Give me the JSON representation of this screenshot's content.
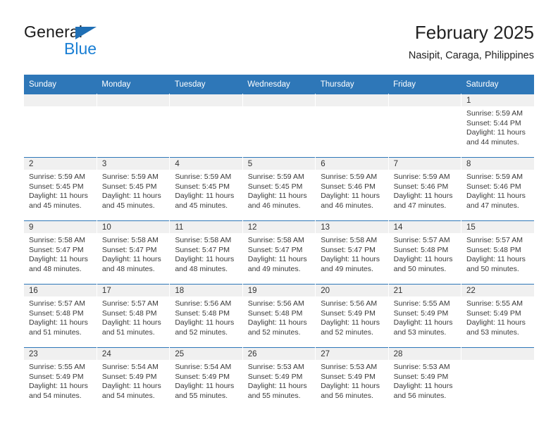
{
  "brand": {
    "name_part1": "General",
    "name_part2": "Blue",
    "triangle_color": "#1f6fb5",
    "blue_color": "#1a7fd4"
  },
  "header": {
    "month_title": "February 2025",
    "location": "Nasipit, Caraga, Philippines"
  },
  "theme": {
    "header_row_bg": "#2e77b8",
    "daynum_band_bg": "#f0f0f0",
    "row_divider": "#2e77b8"
  },
  "weekday_headers": [
    "Sunday",
    "Monday",
    "Tuesday",
    "Wednesday",
    "Thursday",
    "Friday",
    "Saturday"
  ],
  "weeks": [
    [
      {
        "day": "",
        "empty": true
      },
      {
        "day": "",
        "empty": true
      },
      {
        "day": "",
        "empty": true
      },
      {
        "day": "",
        "empty": true
      },
      {
        "day": "",
        "empty": true
      },
      {
        "day": "",
        "empty": true
      },
      {
        "day": "1",
        "sunrise": "Sunrise: 5:59 AM",
        "sunset": "Sunset: 5:44 PM",
        "daylight": "Daylight: 11 hours and 44 minutes."
      }
    ],
    [
      {
        "day": "2",
        "sunrise": "Sunrise: 5:59 AM",
        "sunset": "Sunset: 5:45 PM",
        "daylight": "Daylight: 11 hours and 45 minutes."
      },
      {
        "day": "3",
        "sunrise": "Sunrise: 5:59 AM",
        "sunset": "Sunset: 5:45 PM",
        "daylight": "Daylight: 11 hours and 45 minutes."
      },
      {
        "day": "4",
        "sunrise": "Sunrise: 5:59 AM",
        "sunset": "Sunset: 5:45 PM",
        "daylight": "Daylight: 11 hours and 45 minutes."
      },
      {
        "day": "5",
        "sunrise": "Sunrise: 5:59 AM",
        "sunset": "Sunset: 5:45 PM",
        "daylight": "Daylight: 11 hours and 46 minutes."
      },
      {
        "day": "6",
        "sunrise": "Sunrise: 5:59 AM",
        "sunset": "Sunset: 5:46 PM",
        "daylight": "Daylight: 11 hours and 46 minutes."
      },
      {
        "day": "7",
        "sunrise": "Sunrise: 5:59 AM",
        "sunset": "Sunset: 5:46 PM",
        "daylight": "Daylight: 11 hours and 47 minutes."
      },
      {
        "day": "8",
        "sunrise": "Sunrise: 5:59 AM",
        "sunset": "Sunset: 5:46 PM",
        "daylight": "Daylight: 11 hours and 47 minutes."
      }
    ],
    [
      {
        "day": "9",
        "sunrise": "Sunrise: 5:58 AM",
        "sunset": "Sunset: 5:47 PM",
        "daylight": "Daylight: 11 hours and 48 minutes."
      },
      {
        "day": "10",
        "sunrise": "Sunrise: 5:58 AM",
        "sunset": "Sunset: 5:47 PM",
        "daylight": "Daylight: 11 hours and 48 minutes."
      },
      {
        "day": "11",
        "sunrise": "Sunrise: 5:58 AM",
        "sunset": "Sunset: 5:47 PM",
        "daylight": "Daylight: 11 hours and 48 minutes."
      },
      {
        "day": "12",
        "sunrise": "Sunrise: 5:58 AM",
        "sunset": "Sunset: 5:47 PM",
        "daylight": "Daylight: 11 hours and 49 minutes."
      },
      {
        "day": "13",
        "sunrise": "Sunrise: 5:58 AM",
        "sunset": "Sunset: 5:47 PM",
        "daylight": "Daylight: 11 hours and 49 minutes."
      },
      {
        "day": "14",
        "sunrise": "Sunrise: 5:57 AM",
        "sunset": "Sunset: 5:48 PM",
        "daylight": "Daylight: 11 hours and 50 minutes."
      },
      {
        "day": "15",
        "sunrise": "Sunrise: 5:57 AM",
        "sunset": "Sunset: 5:48 PM",
        "daylight": "Daylight: 11 hours and 50 minutes."
      }
    ],
    [
      {
        "day": "16",
        "sunrise": "Sunrise: 5:57 AM",
        "sunset": "Sunset: 5:48 PM",
        "daylight": "Daylight: 11 hours and 51 minutes."
      },
      {
        "day": "17",
        "sunrise": "Sunrise: 5:57 AM",
        "sunset": "Sunset: 5:48 PM",
        "daylight": "Daylight: 11 hours and 51 minutes."
      },
      {
        "day": "18",
        "sunrise": "Sunrise: 5:56 AM",
        "sunset": "Sunset: 5:48 PM",
        "daylight": "Daylight: 11 hours and 52 minutes."
      },
      {
        "day": "19",
        "sunrise": "Sunrise: 5:56 AM",
        "sunset": "Sunset: 5:48 PM",
        "daylight": "Daylight: 11 hours and 52 minutes."
      },
      {
        "day": "20",
        "sunrise": "Sunrise: 5:56 AM",
        "sunset": "Sunset: 5:49 PM",
        "daylight": "Daylight: 11 hours and 52 minutes."
      },
      {
        "day": "21",
        "sunrise": "Sunrise: 5:55 AM",
        "sunset": "Sunset: 5:49 PM",
        "daylight": "Daylight: 11 hours and 53 minutes."
      },
      {
        "day": "22",
        "sunrise": "Sunrise: 5:55 AM",
        "sunset": "Sunset: 5:49 PM",
        "daylight": "Daylight: 11 hours and 53 minutes."
      }
    ],
    [
      {
        "day": "23",
        "sunrise": "Sunrise: 5:55 AM",
        "sunset": "Sunset: 5:49 PM",
        "daylight": "Daylight: 11 hours and 54 minutes."
      },
      {
        "day": "24",
        "sunrise": "Sunrise: 5:54 AM",
        "sunset": "Sunset: 5:49 PM",
        "daylight": "Daylight: 11 hours and 54 minutes."
      },
      {
        "day": "25",
        "sunrise": "Sunrise: 5:54 AM",
        "sunset": "Sunset: 5:49 PM",
        "daylight": "Daylight: 11 hours and 55 minutes."
      },
      {
        "day": "26",
        "sunrise": "Sunrise: 5:53 AM",
        "sunset": "Sunset: 5:49 PM",
        "daylight": "Daylight: 11 hours and 55 minutes."
      },
      {
        "day": "27",
        "sunrise": "Sunrise: 5:53 AM",
        "sunset": "Sunset: 5:49 PM",
        "daylight": "Daylight: 11 hours and 56 minutes."
      },
      {
        "day": "28",
        "sunrise": "Sunrise: 5:53 AM",
        "sunset": "Sunset: 5:49 PM",
        "daylight": "Daylight: 11 hours and 56 minutes."
      },
      {
        "day": "",
        "empty": true
      }
    ]
  ]
}
